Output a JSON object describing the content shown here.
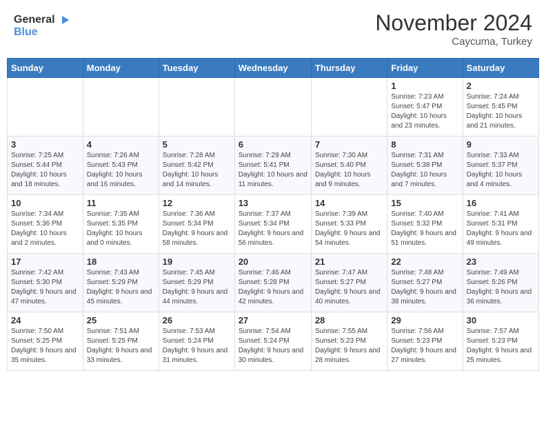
{
  "header": {
    "logo_general": "General",
    "logo_blue": "Blue",
    "month_title": "November 2024",
    "location": "Caycuma, Turkey"
  },
  "weekdays": [
    "Sunday",
    "Monday",
    "Tuesday",
    "Wednesday",
    "Thursday",
    "Friday",
    "Saturday"
  ],
  "weeks": [
    [
      {
        "day": "",
        "info": ""
      },
      {
        "day": "",
        "info": ""
      },
      {
        "day": "",
        "info": ""
      },
      {
        "day": "",
        "info": ""
      },
      {
        "day": "",
        "info": ""
      },
      {
        "day": "1",
        "info": "Sunrise: 7:23 AM\nSunset: 5:47 PM\nDaylight: 10 hours and 23 minutes."
      },
      {
        "day": "2",
        "info": "Sunrise: 7:24 AM\nSunset: 5:45 PM\nDaylight: 10 hours and 21 minutes."
      }
    ],
    [
      {
        "day": "3",
        "info": "Sunrise: 7:25 AM\nSunset: 5:44 PM\nDaylight: 10 hours and 18 minutes."
      },
      {
        "day": "4",
        "info": "Sunrise: 7:26 AM\nSunset: 5:43 PM\nDaylight: 10 hours and 16 minutes."
      },
      {
        "day": "5",
        "info": "Sunrise: 7:28 AM\nSunset: 5:42 PM\nDaylight: 10 hours and 14 minutes."
      },
      {
        "day": "6",
        "info": "Sunrise: 7:29 AM\nSunset: 5:41 PM\nDaylight: 10 hours and 11 minutes."
      },
      {
        "day": "7",
        "info": "Sunrise: 7:30 AM\nSunset: 5:40 PM\nDaylight: 10 hours and 9 minutes."
      },
      {
        "day": "8",
        "info": "Sunrise: 7:31 AM\nSunset: 5:38 PM\nDaylight: 10 hours and 7 minutes."
      },
      {
        "day": "9",
        "info": "Sunrise: 7:33 AM\nSunset: 5:37 PM\nDaylight: 10 hours and 4 minutes."
      }
    ],
    [
      {
        "day": "10",
        "info": "Sunrise: 7:34 AM\nSunset: 5:36 PM\nDaylight: 10 hours and 2 minutes."
      },
      {
        "day": "11",
        "info": "Sunrise: 7:35 AM\nSunset: 5:35 PM\nDaylight: 10 hours and 0 minutes."
      },
      {
        "day": "12",
        "info": "Sunrise: 7:36 AM\nSunset: 5:34 PM\nDaylight: 9 hours and 58 minutes."
      },
      {
        "day": "13",
        "info": "Sunrise: 7:37 AM\nSunset: 5:34 PM\nDaylight: 9 hours and 56 minutes."
      },
      {
        "day": "14",
        "info": "Sunrise: 7:39 AM\nSunset: 5:33 PM\nDaylight: 9 hours and 54 minutes."
      },
      {
        "day": "15",
        "info": "Sunrise: 7:40 AM\nSunset: 5:32 PM\nDaylight: 9 hours and 51 minutes."
      },
      {
        "day": "16",
        "info": "Sunrise: 7:41 AM\nSunset: 5:31 PM\nDaylight: 9 hours and 49 minutes."
      }
    ],
    [
      {
        "day": "17",
        "info": "Sunrise: 7:42 AM\nSunset: 5:30 PM\nDaylight: 9 hours and 47 minutes."
      },
      {
        "day": "18",
        "info": "Sunrise: 7:43 AM\nSunset: 5:29 PM\nDaylight: 9 hours and 45 minutes."
      },
      {
        "day": "19",
        "info": "Sunrise: 7:45 AM\nSunset: 5:29 PM\nDaylight: 9 hours and 44 minutes."
      },
      {
        "day": "20",
        "info": "Sunrise: 7:46 AM\nSunset: 5:28 PM\nDaylight: 9 hours and 42 minutes."
      },
      {
        "day": "21",
        "info": "Sunrise: 7:47 AM\nSunset: 5:27 PM\nDaylight: 9 hours and 40 minutes."
      },
      {
        "day": "22",
        "info": "Sunrise: 7:48 AM\nSunset: 5:27 PM\nDaylight: 9 hours and 38 minutes."
      },
      {
        "day": "23",
        "info": "Sunrise: 7:49 AM\nSunset: 5:26 PM\nDaylight: 9 hours and 36 minutes."
      }
    ],
    [
      {
        "day": "24",
        "info": "Sunrise: 7:50 AM\nSunset: 5:25 PM\nDaylight: 9 hours and 35 minutes."
      },
      {
        "day": "25",
        "info": "Sunrise: 7:51 AM\nSunset: 5:25 PM\nDaylight: 9 hours and 33 minutes."
      },
      {
        "day": "26",
        "info": "Sunrise: 7:53 AM\nSunset: 5:24 PM\nDaylight: 9 hours and 31 minutes."
      },
      {
        "day": "27",
        "info": "Sunrise: 7:54 AM\nSunset: 5:24 PM\nDaylight: 9 hours and 30 minutes."
      },
      {
        "day": "28",
        "info": "Sunrise: 7:55 AM\nSunset: 5:23 PM\nDaylight: 9 hours and 28 minutes."
      },
      {
        "day": "29",
        "info": "Sunrise: 7:56 AM\nSunset: 5:23 PM\nDaylight: 9 hours and 27 minutes."
      },
      {
        "day": "30",
        "info": "Sunrise: 7:57 AM\nSunset: 5:23 PM\nDaylight: 9 hours and 25 minutes."
      }
    ]
  ]
}
